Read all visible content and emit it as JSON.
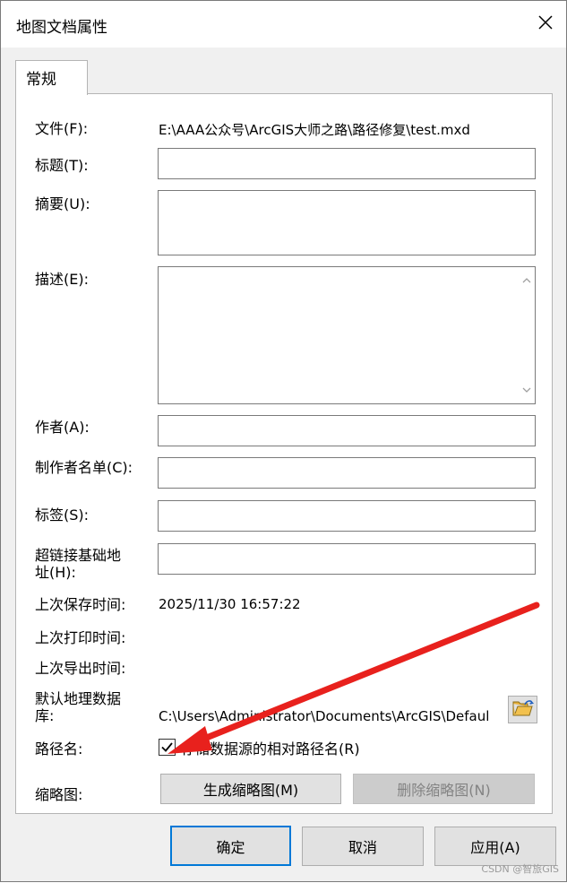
{
  "window": {
    "title": "地图文档属性",
    "close_icon": "close-icon"
  },
  "tabs": [
    {
      "label": "常规",
      "selected": true
    }
  ],
  "general": {
    "file_label": "文件(F):",
    "file_value": "E:\\AAA公众号\\ArcGIS大师之路\\路径修复\\test.mxd",
    "title_label": "标题(T):",
    "title_value": "",
    "summary_label": "摘要(U):",
    "summary_value": "",
    "description_label": "描述(E):",
    "description_value": "",
    "author_label": "作者(A):",
    "author_value": "",
    "credits_label": "制作者名单(C):",
    "credits_value": "",
    "tags_label": "标签(S):",
    "tags_value": "",
    "hyperlink_label": "超链接基础地址(H):",
    "hyperlink_value": "",
    "last_saved_label": "上次保存时间:",
    "last_saved_value": "2025/11/30 16:57:22",
    "last_printed_label": "上次打印时间:",
    "last_printed_value": "",
    "last_exported_label": "上次导出时间:",
    "last_exported_value": "",
    "default_gdb_label": "默认地理数据库:",
    "default_gdb_value": "C:\\Users\\Administrator\\Documents\\ArcGIS\\Defaul",
    "pathnames_label": "路径名:",
    "relative_paths_label": "存储数据源的相对路径名(R)",
    "relative_paths_checked": true,
    "thumbnail_label": "缩略图:",
    "make_thumbnail_label": "生成缩略图(M)",
    "delete_thumbnail_label": "删除缩略图(N)"
  },
  "footer": {
    "ok_label": "确定",
    "cancel_label": "取消",
    "apply_label": "应用(A)"
  },
  "watermark": "CSDN @智旅GIS",
  "colors": {
    "annotation_arrow": "#e8211d",
    "default_button_border": "#0078d7"
  }
}
